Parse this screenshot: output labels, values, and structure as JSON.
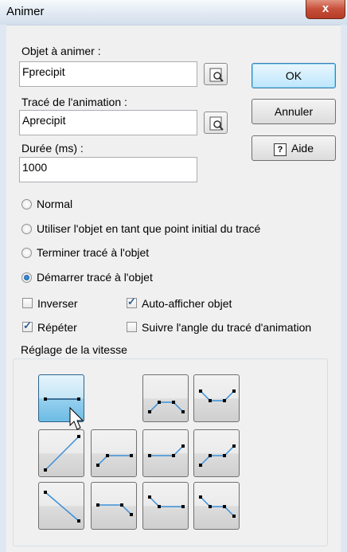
{
  "window": {
    "title": "Animer",
    "close_glyph": "x"
  },
  "fields": {
    "object_label": "Objet à animer :",
    "object_value": "Fprecipit",
    "path_label": "Tracé de l'animation :",
    "path_value": "Aprecipit",
    "duration_label": "Durée (ms) :",
    "duration_value": "1000"
  },
  "buttons": {
    "ok": "OK",
    "cancel": "Annuler",
    "help": "Aide"
  },
  "radios": [
    {
      "label": "Normal",
      "selected": false
    },
    {
      "label": "Utiliser l'objet en tant que point initial du tracé",
      "selected": false
    },
    {
      "label": "Terminer tracé à l'objet",
      "selected": false
    },
    {
      "label": "Démarrer tracé à l'objet",
      "selected": true
    }
  ],
  "checks": [
    {
      "label": "Inverser",
      "checked": false
    },
    {
      "label": "Auto-afficher objet",
      "checked": true
    },
    {
      "label": "Répéter",
      "checked": true
    },
    {
      "label": "Suivre l'angle du tracé d'animation",
      "checked": false
    }
  ],
  "speed": {
    "group_title": "Réglage de la vitesse",
    "selected": "constant"
  },
  "colors": {
    "accent": "#3c7fb1",
    "curve": "#3a8fd8",
    "point": "#000000"
  }
}
